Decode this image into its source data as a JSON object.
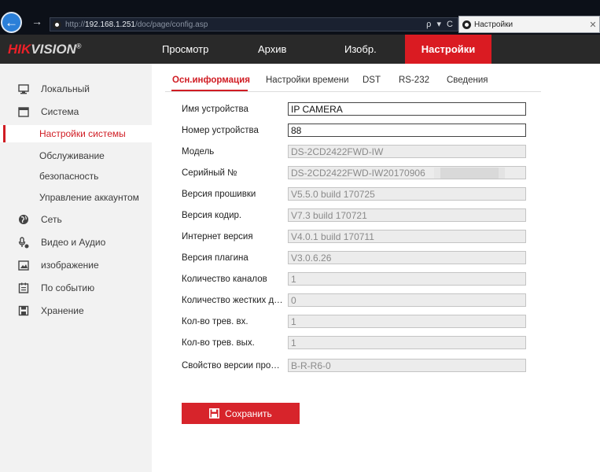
{
  "browser": {
    "url_prefix": "http://",
    "url_host": "192.168.1.251",
    "url_path": "/doc/page/config.asp",
    "url_actions": "ρ ▾ C",
    "tab_title": "Настройки",
    "close_glyph": "✕"
  },
  "header": {
    "logo_part1": "HIK",
    "logo_part2": "VISION",
    "logo_mark": "®",
    "nav": [
      "Просмотр",
      "Архив",
      "Изобр.",
      "Настройки"
    ],
    "active_nav": "Настройки"
  },
  "sidebar": {
    "items": [
      {
        "label": "Локальный",
        "icon": "monitor-icon"
      },
      {
        "label": "Система",
        "icon": "system-window-icon"
      },
      {
        "label": "Настройки системы",
        "sub": true,
        "active": true
      },
      {
        "label": "Обслуживание",
        "sub": true
      },
      {
        "label": "безопасность",
        "sub": true
      },
      {
        "label": "Управление аккаунтом",
        "sub": true
      },
      {
        "label": "Сеть",
        "icon": "globe-icon"
      },
      {
        "label": "Видео и Аудио",
        "icon": "microphone-icon"
      },
      {
        "label": "изображение",
        "icon": "image-icon"
      },
      {
        "label": "По событию",
        "icon": "calendar-icon"
      },
      {
        "label": "Хранение",
        "icon": "floppy-disk-icon"
      }
    ]
  },
  "tabs": [
    {
      "label": "Осн.информация",
      "active": true
    },
    {
      "label": "Настройки времени"
    },
    {
      "label": "DST"
    },
    {
      "label": "RS-232"
    },
    {
      "label": "Сведения"
    }
  ],
  "form": {
    "fields": [
      {
        "label": "Имя устройства",
        "value": "IP CAMERA",
        "editable": true
      },
      {
        "label": "Номер устройства",
        "value": "88",
        "editable": true
      },
      {
        "label": "Модель",
        "value": "DS-2CD2422FWD-IW",
        "editable": false
      },
      {
        "label": "Серийный №",
        "value": "DS-2CD2422FWD-IW20170906",
        "editable": false
      },
      {
        "label": "Версия прошивки",
        "value": "V5.5.0 build 170725",
        "editable": false
      },
      {
        "label": "Версия кодир.",
        "value": "V7.3 build 170721",
        "editable": false
      },
      {
        "label": "Интернет версия",
        "value": "V4.0.1 build 170711",
        "editable": false
      },
      {
        "label": "Версия плагина",
        "value": "V3.0.6.26",
        "editable": false
      },
      {
        "label": "Количество каналов",
        "value": "1",
        "editable": false
      },
      {
        "label": "Количество жестких дисков",
        "value": "0",
        "editable": false
      },
      {
        "label": "Кол-во трев. вх.",
        "value": "1",
        "editable": false
      },
      {
        "label": "Кол-во трев. вых.",
        "value": "1",
        "editable": false
      },
      {
        "label": "Свойство версии прошивки",
        "value": "B-R-R6-0",
        "editable": false
      }
    ],
    "save_label": "Сохранить"
  },
  "colors": {
    "accent": "#d7242b",
    "header_bg": "#292929",
    "sidebar_bg": "#f2f2f2"
  }
}
